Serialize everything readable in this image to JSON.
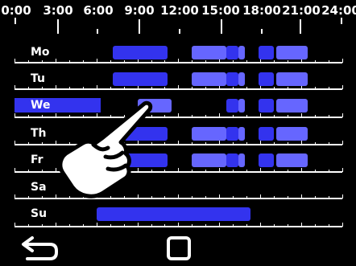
{
  "time_axis": {
    "labels": [
      "0:00",
      "3:00",
      "6:00",
      "9:00",
      "12:00",
      "15:00",
      "18:00",
      "21:00",
      "24:00"
    ]
  },
  "days": [
    {
      "key": "mo",
      "label": "Mo",
      "selected": false
    },
    {
      "key": "tu",
      "label": "Tu",
      "selected": false
    },
    {
      "key": "we",
      "label": "We",
      "selected": true
    },
    {
      "key": "th",
      "label": "Th",
      "selected": false
    },
    {
      "key": "fr",
      "label": "Fr",
      "selected": false
    },
    {
      "key": "sa",
      "label": "Sa",
      "selected": false
    },
    {
      "key": "su",
      "label": "Su",
      "selected": false
    }
  ],
  "schedule": {
    "mo": [
      {
        "start": 7.2,
        "end": 11.2,
        "level": "high"
      },
      {
        "start": 13.0,
        "end": 15.5,
        "level": "mid"
      },
      {
        "start": 15.5,
        "end": 16.4,
        "level": "high"
      },
      {
        "start": 16.4,
        "end": 16.9,
        "level": "mid"
      },
      {
        "start": 17.9,
        "end": 19.0,
        "level": "high"
      },
      {
        "start": 19.2,
        "end": 21.5,
        "level": "mid"
      }
    ],
    "tu": [
      {
        "start": 7.2,
        "end": 11.2,
        "level": "high"
      },
      {
        "start": 13.0,
        "end": 15.5,
        "level": "mid"
      },
      {
        "start": 15.5,
        "end": 16.4,
        "level": "high"
      },
      {
        "start": 16.4,
        "end": 16.9,
        "level": "mid"
      },
      {
        "start": 17.9,
        "end": 19.0,
        "level": "high"
      },
      {
        "start": 19.2,
        "end": 21.5,
        "level": "mid"
      }
    ],
    "we": [
      {
        "start": 9.0,
        "end": 11.5,
        "level": "mid"
      },
      {
        "start": 15.5,
        "end": 16.4,
        "level": "high"
      },
      {
        "start": 16.4,
        "end": 16.9,
        "level": "mid"
      },
      {
        "start": 17.9,
        "end": 19.0,
        "level": "high"
      },
      {
        "start": 19.2,
        "end": 21.5,
        "level": "mid"
      }
    ],
    "th": [
      {
        "start": 8.0,
        "end": 11.2,
        "level": "high"
      },
      {
        "start": 13.0,
        "end": 15.5,
        "level": "mid"
      },
      {
        "start": 15.5,
        "end": 16.4,
        "level": "high"
      },
      {
        "start": 16.4,
        "end": 16.9,
        "level": "mid"
      },
      {
        "start": 17.9,
        "end": 19.0,
        "level": "high"
      },
      {
        "start": 19.2,
        "end": 21.5,
        "level": "mid"
      }
    ],
    "fr": [
      {
        "start": 8.0,
        "end": 11.2,
        "level": "high"
      },
      {
        "start": 13.0,
        "end": 15.5,
        "level": "mid"
      },
      {
        "start": 15.5,
        "end": 16.4,
        "level": "high"
      },
      {
        "start": 16.4,
        "end": 16.9,
        "level": "mid"
      },
      {
        "start": 17.9,
        "end": 19.0,
        "level": "high"
      },
      {
        "start": 19.2,
        "end": 21.5,
        "level": "mid"
      }
    ],
    "sa": [],
    "su": [
      {
        "start": 6.0,
        "end": 17.3,
        "level": "high"
      }
    ]
  },
  "colors": {
    "background": "#000000",
    "foreground": "#ffffff",
    "selected_day": "#3333ee",
    "segment_high": "#3333ee",
    "segment_mid": "#6666ff"
  },
  "footer": {
    "back_icon": "back-arrow-icon",
    "stop_icon": "stop-square-icon"
  },
  "overlay": {
    "icon": "pointing-hand-icon"
  }
}
